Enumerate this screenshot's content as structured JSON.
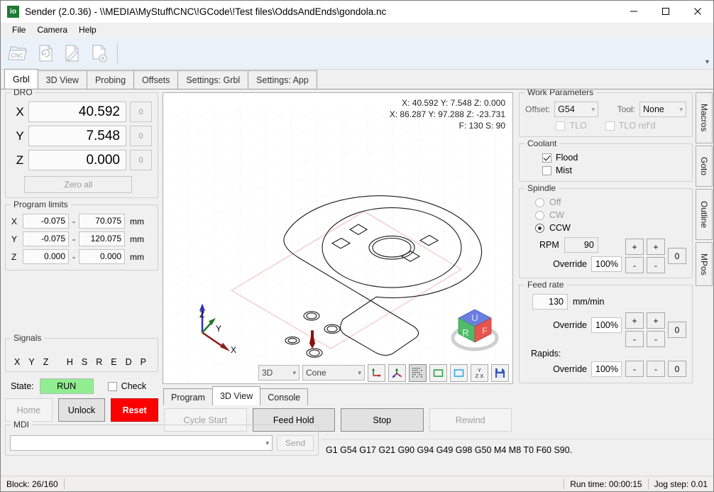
{
  "window": {
    "app_icon_text": "io",
    "title": "Sender (2.0.36) - \\\\MEDIA\\MyStuff\\CNC\\!GCode\\!Test files\\OddsAndEnds\\gondola.nc",
    "minimize_label": "minimize-icon",
    "maximize_label": "maximize-icon",
    "close_label": "close-icon"
  },
  "menu": {
    "items": [
      "File",
      "Camera",
      "Help"
    ]
  },
  "toolbar": {
    "buttons": [
      {
        "name": "open-cnc-folder-icon",
        "label": "CNC"
      },
      {
        "name": "reload-file-icon",
        "label": ""
      },
      {
        "name": "edit-file-icon",
        "label": ""
      },
      {
        "name": "close-file-icon",
        "label": ""
      }
    ],
    "overflow_label": "▾"
  },
  "tabs": {
    "items": [
      "Grbl",
      "3D View",
      "Probing",
      "Offsets",
      "Settings: Grbl",
      "Settings: App"
    ],
    "active": "Grbl"
  },
  "dro": {
    "title": "DRO",
    "axes": [
      {
        "axis": "X",
        "value": "40.592",
        "zero": "0"
      },
      {
        "axis": "Y",
        "value": "7.548",
        "zero": "0"
      },
      {
        "axis": "Z",
        "value": "0.000",
        "zero": "0"
      }
    ],
    "zero_all_label": "Zero all"
  },
  "program_limits": {
    "title": "Program limits",
    "unit": "mm",
    "dash": "-",
    "rows": [
      {
        "axis": "X",
        "min": "-0.075",
        "max": "70.075"
      },
      {
        "axis": "Y",
        "min": "-0.075",
        "max": "120.075"
      },
      {
        "axis": "Z",
        "min": "0.000",
        "max": "0.000"
      }
    ]
  },
  "signals": {
    "title": "Signals",
    "left": [
      "X",
      "Y",
      "Z"
    ],
    "right": [
      "H",
      "S",
      "R",
      "E",
      "D",
      "P"
    ]
  },
  "state": {
    "label": "State:",
    "value": "RUN",
    "badge_color": "#90ee90",
    "check_label": "Check",
    "check_checked": false
  },
  "machine_buttons": {
    "home": "Home",
    "unlock": "Unlock",
    "reset": "Reset",
    "reset_color": "#fc0000"
  },
  "mdi": {
    "title": "MDI",
    "value": "",
    "placeholder": "",
    "send_label": "Send"
  },
  "viewport": {
    "hud_line1": "X: 40.592  Y: 7.548  Z: 0.000",
    "hud_line2": "X: 86.287  Y: 97.288  Z: -23.731",
    "hud_line3": "F: 130  S: 90",
    "axis_labels": {
      "x": "X",
      "y": "Y",
      "z": "Z"
    },
    "viewcube_faces": {
      "top": "U",
      "left": "R",
      "right": "F"
    },
    "toolbar": {
      "view_mode": "3D",
      "tool_shape": "Cone",
      "buttons": [
        {
          "name": "machine-origin-axes-icon"
        },
        {
          "name": "work-origin-axes-icon"
        },
        {
          "name": "toggle-grid-icon"
        },
        {
          "name": "show-program-bounds-icon"
        },
        {
          "name": "show-machine-bounds-icon"
        },
        {
          "name": "axis-labels-icon",
          "label": "Y\nZ X"
        },
        {
          "name": "save-view-icon"
        }
      ]
    }
  },
  "center_tabs": {
    "items": [
      "Program",
      "3D View",
      "Console"
    ],
    "active": "3D View"
  },
  "control_buttons": [
    {
      "label": "Cycle Start",
      "enabled": false
    },
    {
      "label": "Feed Hold",
      "enabled": true
    },
    {
      "label": "Stop",
      "enabled": true
    },
    {
      "label": "Rewind",
      "enabled": false
    }
  ],
  "work_parameters": {
    "title": "Work Parameters",
    "offset_label": "Offset:",
    "offset_value": "G54",
    "tool_label": "Tool:",
    "tool_value": "None",
    "tlo_label": "TLO",
    "tlo_checked": false,
    "tlo_refd_label": "TLO ref'd",
    "tlo_refd_checked": false
  },
  "coolant": {
    "title": "Coolant",
    "flood_label": "Flood",
    "flood_checked": true,
    "mist_label": "Mist",
    "mist_checked": false
  },
  "spindle": {
    "title": "Spindle",
    "modes": [
      {
        "label": "Off",
        "selected": false
      },
      {
        "label": "CW",
        "selected": false
      },
      {
        "label": "CCW",
        "selected": true
      }
    ],
    "rpm_label": "RPM",
    "rpm_value": "90",
    "override_label": "Override",
    "override_value": "100%",
    "plus_big": "+",
    "plus_small": "+",
    "minus_big": "-",
    "minus_small": "-",
    "reset_value": "0"
  },
  "feed_rate": {
    "title": "Feed rate",
    "value": "130",
    "unit": "mm/min",
    "override_label": "Override",
    "override_value": "100%",
    "plus_big": "+",
    "plus_small": "+",
    "minus_big": "-",
    "minus_small": "-",
    "reset_value": "0",
    "rapids_label": "Rapids:",
    "rapids_override_label": "Override",
    "rapids_override_value": "100%",
    "rapids_minus_big": "-",
    "rapids_minus_small": "-",
    "rapids_reset_value": "0"
  },
  "vertical_tabs": [
    "Macros",
    "Goto",
    "Outline",
    "MPos"
  ],
  "gcode_status": "G1 G54 G17 G21 G90 G94 G49 G98 G50 M4 M8 T0 F60 S90.",
  "status_bar": {
    "block": "Block: 26/160",
    "run_time": "Run time: 00:00:15",
    "jog_step": "Jog step: 0.01"
  }
}
